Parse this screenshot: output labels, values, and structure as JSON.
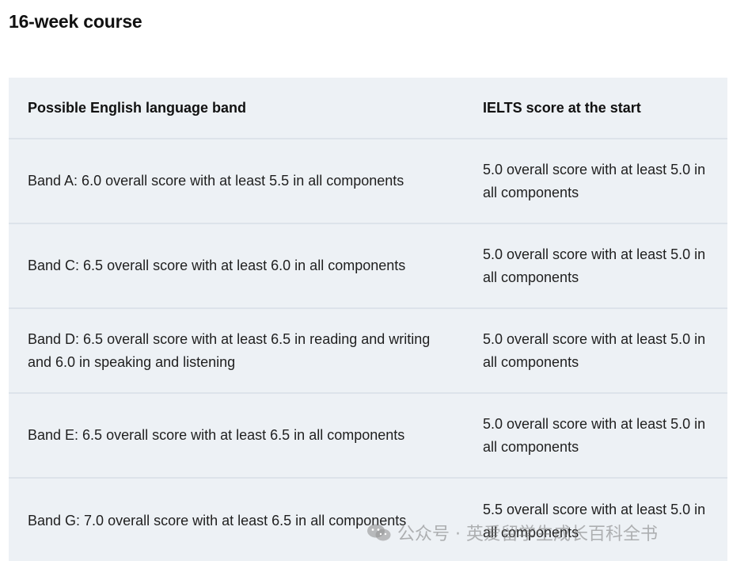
{
  "page": {
    "title": "16-week course"
  },
  "table": {
    "headers": [
      "Possible English language band",
      "IELTS score at the start"
    ],
    "rows": [
      [
        "Band A: 6.0 overall score with at least 5.5 in all components",
        "5.0 overall score with at least 5.0 in all components"
      ],
      [
        "Band C: 6.5 overall score with at least 6.0 in all components",
        "5.0 overall score with at least 5.0 in all components"
      ],
      [
        "Band D: 6.5 overall score with at least 6.5 in reading and writing and 6.0 in speaking and listening",
        "5.0 overall score with at least 5.0 in all components"
      ],
      [
        "Band E: 6.5 overall score with at least 6.5 in all components",
        "5.0 overall score with at least 5.0 in all components"
      ],
      [
        "Band G: 7.0 overall score with at least 6.5 in all components",
        "5.5 overall score with at least 5.0 in all components"
      ]
    ]
  },
  "watermark": {
    "icon": "wechat-icon",
    "text": "公众号 · 英爱留学生成长百科全书"
  }
}
